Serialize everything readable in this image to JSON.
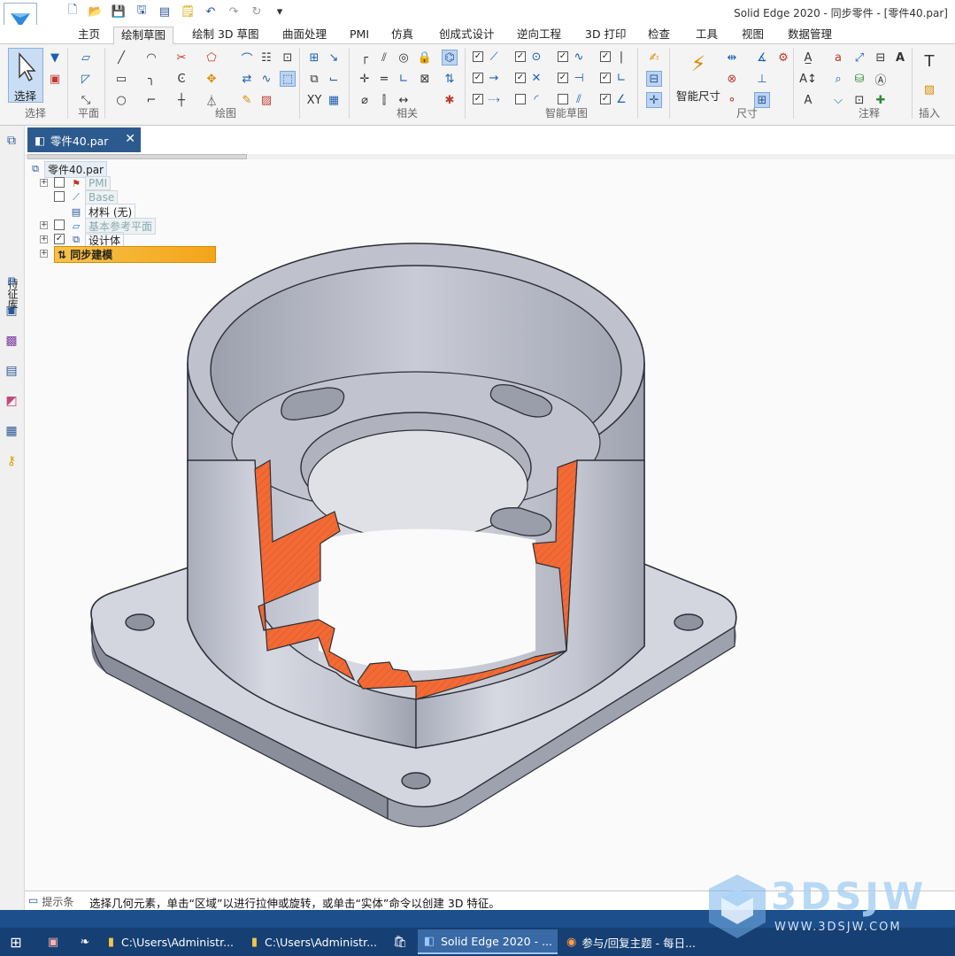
{
  "window": {
    "title": "Solid Edge 2020 - 同步零件 - [零件40.par]"
  },
  "ribbon_tabs": [
    "主页",
    "绘制草图",
    "绘制 3D 草图",
    "曲面处理",
    "PMI",
    "仿真",
    "创成式设计",
    "逆向工程",
    "3D 打印",
    "检查",
    "工具",
    "视图",
    "数据管理"
  ],
  "active_tab": "绘制草图",
  "ribbon": {
    "select_label": "选择",
    "smart_dimension_label": "智能尺寸",
    "groups": {
      "select": "选择",
      "plane": "平面",
      "draw": "绘图",
      "relate": "相关",
      "intellisketch": "智能草图",
      "dimension": "尺寸",
      "annotation": "注释",
      "insert": "插入"
    }
  },
  "left_panel": {
    "feature_library_label": "特征库"
  },
  "document_tab": {
    "name": "零件40.par"
  },
  "tree": {
    "root": "零件40.par",
    "items": [
      {
        "label": "PMI",
        "checked": false
      },
      {
        "label": "Base",
        "checked": false
      },
      {
        "label": "材料 (无)"
      },
      {
        "label": "基本参考平面",
        "checked": false
      },
      {
        "label": "设计体",
        "checked": true
      },
      {
        "label": "同步建模"
      }
    ]
  },
  "prompt": {
    "label": "提示条",
    "text": "选择几何元素，单击“区域”以进行拉伸或旋转，或单击“实体”命令以创建 3D 特征。"
  },
  "taskbar": {
    "items": [
      "C:\\Users\\Administr...",
      "C:\\Users\\Administr...",
      "Solid Edge 2020 - ...",
      "参与/回复主题 - 每日..."
    ]
  },
  "watermark": {
    "text": "3DSJW",
    "url": "WWW.3DSJW.COM"
  },
  "colors": {
    "section_cut": "#f26a35",
    "model_body": "#c9ccd6",
    "doc_tab": "#2c5a8e",
    "taskbar": "#163f73"
  }
}
